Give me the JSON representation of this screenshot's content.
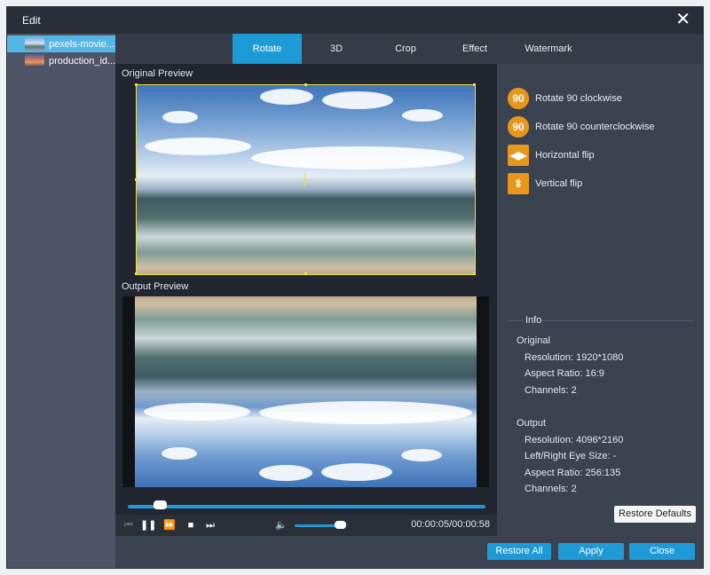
{
  "window": {
    "title": "Edit",
    "close_icon": "close-icon"
  },
  "files": [
    {
      "name": "pexels-movie...",
      "active": true
    },
    {
      "name": "production_id...",
      "active": false
    }
  ],
  "tabs": [
    {
      "label": "Rotate",
      "active": true
    },
    {
      "label": "3D",
      "active": false
    },
    {
      "label": "Crop",
      "active": false
    },
    {
      "label": "Effect",
      "active": false
    },
    {
      "label": "Watermark",
      "active": false
    }
  ],
  "preview": {
    "original_label": "Original Preview",
    "output_label": "Output Preview"
  },
  "player": {
    "time": "00:00:05/00:00:58",
    "progress_fraction": 0.09,
    "volume_fraction": 0.78
  },
  "rotate_actions": [
    {
      "label": "Rotate 90 clockwise",
      "icon": "rotate-clockwise-icon"
    },
    {
      "label": "Rotate 90 counterclockwise",
      "icon": "rotate-counterclockwise-icon"
    },
    {
      "label": "Horizontal flip",
      "icon": "horizontal-flip-icon"
    },
    {
      "label": "Vertical flip",
      "icon": "vertical-flip-icon"
    }
  ],
  "info": {
    "title": "Info",
    "original_heading": "Original",
    "original_resolution": "Resolution: 1920*1080",
    "original_aspect": "Aspect Ratio: 16:9",
    "original_channels": "Channels: 2",
    "output_heading": "Output",
    "output_resolution": "Resolution: 4096*2160",
    "output_eye": "Left/Right Eye Size: -",
    "output_aspect": "Aspect Ratio: 256:135",
    "output_channels": "Channels: 2"
  },
  "buttons": {
    "restore_defaults": "Restore Defaults",
    "restore_all": "Restore All",
    "apply": "Apply",
    "close": "Close"
  },
  "colors": {
    "accent": "#1e9ad7",
    "action_icon": "#e8961c",
    "crop_frame": "#e8e23a"
  }
}
